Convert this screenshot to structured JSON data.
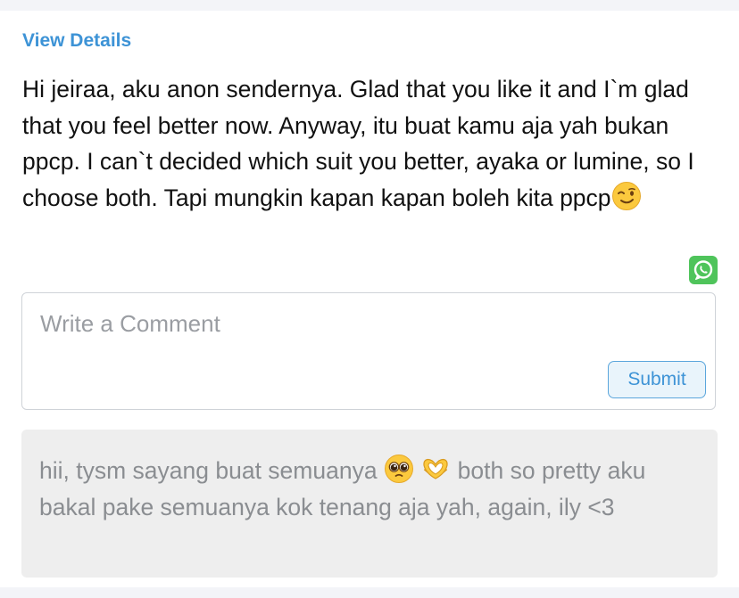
{
  "post": {
    "view_details_label": "View Details",
    "message_text": "Hi jeiraa, aku anon sendernya. Glad that you like it and I`m glad that you feel better now. Anyway, itu buat kamu aja yah bukan ppcp. I can`t decided which suit you better, ayaka or lumine, so I choose both. Tapi mungkin kapan kapan boleh kita ppcp",
    "message_emoji": "winking-face-emoji",
    "share_icon": "whatsapp-icon",
    "share_color": "#4fc45b"
  },
  "comment": {
    "placeholder": "Write a Comment",
    "value": "",
    "submit_label": "Submit",
    "accent_color": "#3d93d6"
  },
  "reply": {
    "text_before_emoji": "hii, tysm sayang buat semuanya ",
    "emojis": [
      "pleading-face-emoji",
      "heart-hands-emoji"
    ],
    "text_after_emoji": " both so pretty aku bakal pake semuanya kok tenang aja yah, again, ily <3"
  }
}
